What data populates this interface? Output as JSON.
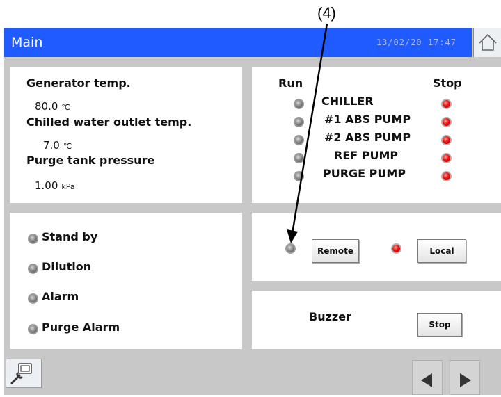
{
  "annotation": {
    "label": "(4)"
  },
  "header": {
    "title": "Main",
    "datetime": "13/02/20 17:47"
  },
  "measurements": [
    {
      "label": "Generator temp.",
      "value": "80.0",
      "unit": "℃"
    },
    {
      "label": "Chilled water outlet temp.",
      "value": "7.0",
      "unit": "℃"
    },
    {
      "label": "Purge tank pressure",
      "value": "1.00",
      "unit": "kPa"
    }
  ],
  "run_stop": {
    "run_header": "Run",
    "stop_header": "Stop",
    "items": [
      "CHILLER",
      "#1 ABS PUMP",
      "#2 ABS PUMP",
      "REF PUMP",
      "PURGE PUMP"
    ]
  },
  "status": {
    "items": [
      "Stand by",
      "Dilution",
      "Alarm",
      "Purge Alarm"
    ]
  },
  "control": {
    "remote_label": "Remote",
    "local_label": "Local"
  },
  "buzzer": {
    "label": "Buzzer",
    "stop_label": "Stop"
  },
  "icons": {
    "home": "home-icon",
    "maintenance": "maintenance-tool-icon",
    "prev": "left-arrow-icon",
    "next": "right-arrow-icon"
  },
  "colors": {
    "titlebar": "#1f5bff",
    "lamp_off": "#8c8c8c",
    "lamp_red": "#ee1111",
    "background": "#c8c8c8"
  }
}
